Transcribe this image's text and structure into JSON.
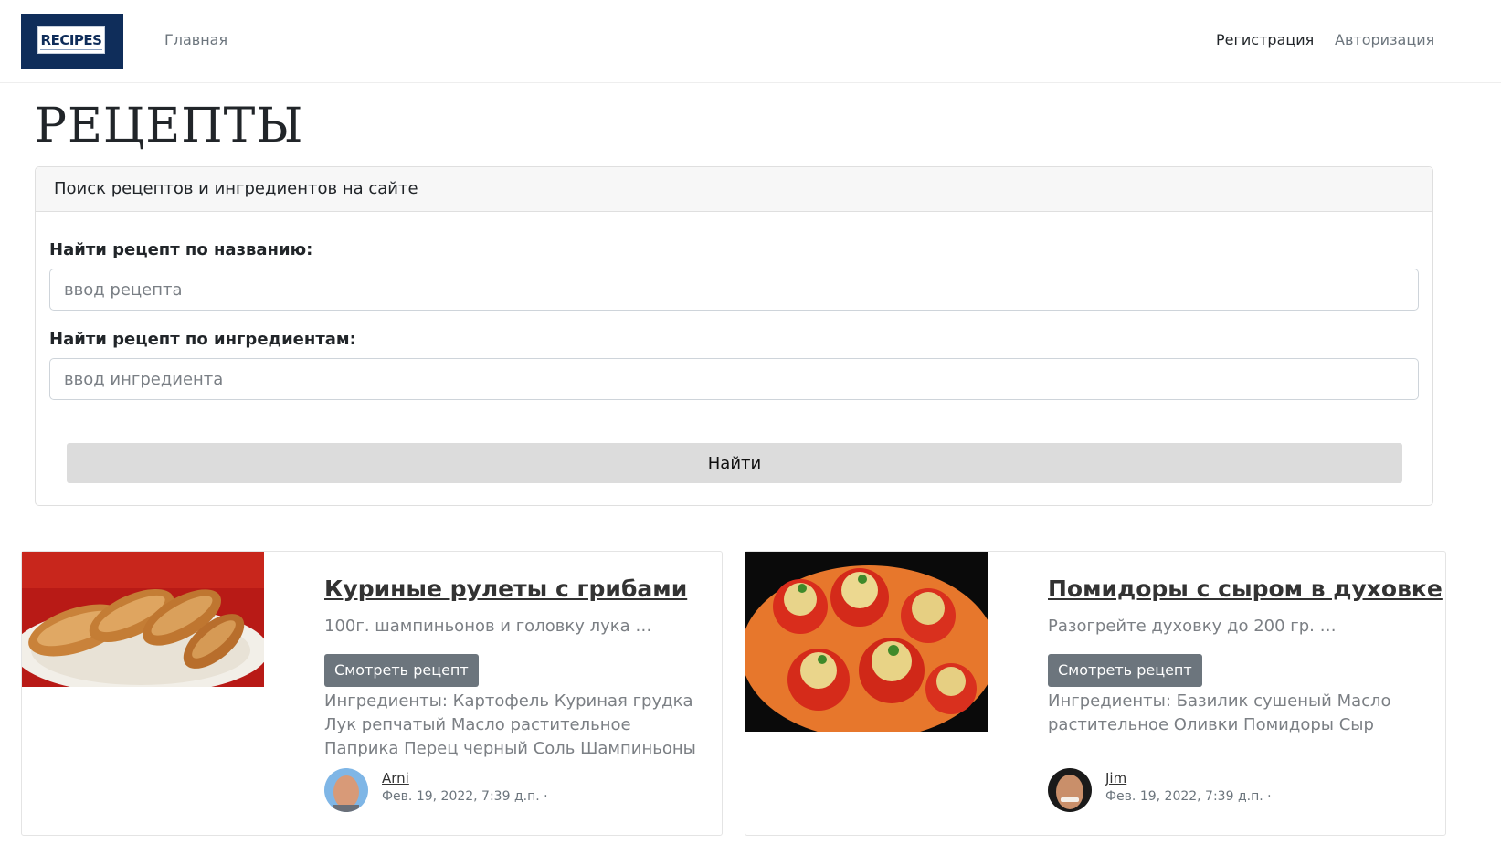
{
  "navbar": {
    "logo_text": "RECIPES",
    "home": "Главная",
    "register": "Регистрация",
    "login": "Авторизация"
  },
  "page": {
    "title": "РЕЦЕПТЫ"
  },
  "search": {
    "header": "Поиск рецептов и ингредиентов на сайте",
    "name_label": "Найти рецепт по названию:",
    "name_placeholder": "ввод рецепта",
    "name_value": "",
    "ingredient_label": "Найти рецепт по ингредиентам:",
    "ingredient_placeholder": "ввод ингредиента",
    "ingredient_value": "",
    "submit_label": "Найти"
  },
  "recipes": [
    {
      "title": "Куриные рулеты с грибами",
      "excerpt": "100г. шампиньонов и головку лука …",
      "button": "Смотреть рецепт",
      "ingredients": "Ингредиенты: Картофель Куриная грудка Лук репчатый Масло растительное Паприка Перец черный Соль Шампиньоны",
      "author": "Arni",
      "date": "Фев. 19, 2022, 7:39 д.п. ·"
    },
    {
      "title": "Помидоры с сыром в духовке",
      "excerpt": "Разогрейте духовку до 200 гр. …",
      "button": "Смотреть рецепт",
      "ingredients": "Ингредиенты: Базилик сушеный Масло растительное Оливки Помидоры Сыр",
      "author": "Jim",
      "date": "Фев. 19, 2022, 7:39 д.п. ·"
    }
  ],
  "colors": {
    "logo_bg": "#0f2d5a",
    "button_secondary": "#6c757d",
    "search_button": "#dcdcdc"
  }
}
